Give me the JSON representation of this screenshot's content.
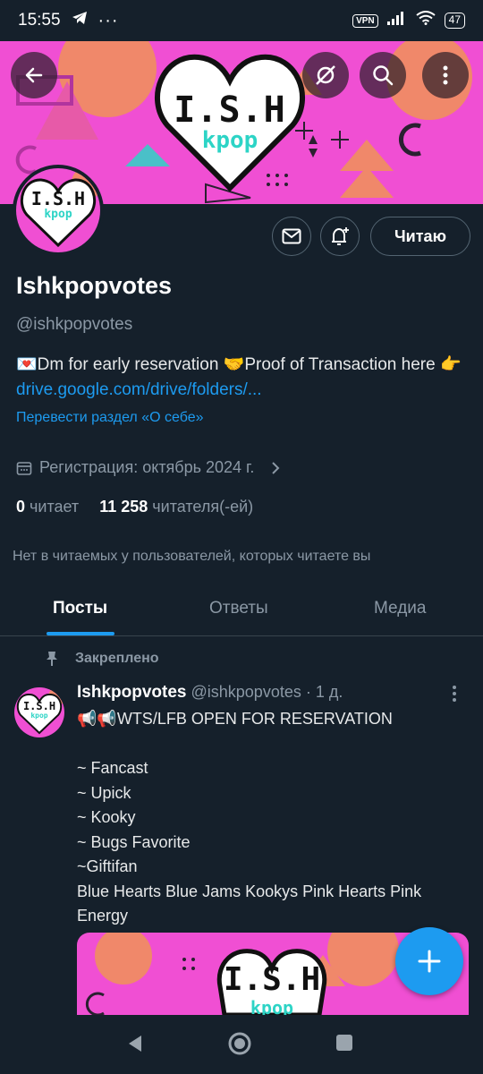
{
  "status_bar": {
    "time": "15:55",
    "vpn": "VPN",
    "battery": "47"
  },
  "banner": {
    "logo_text": "I.S.H",
    "logo_subtext": "kpop"
  },
  "profile": {
    "name": "Ishkpopvotes",
    "handle": "@ishkpopvotes",
    "follow_label": "Читаю",
    "bio_text": "💌Dm for early reservation 🤝Proof of Transaction here 👉 ",
    "bio_link": "drive.google.com/drive/folders/...",
    "translate_label": "Перевести раздел «О себе»",
    "joined": "Регистрация: октябрь 2024 г.",
    "following_count": "0",
    "following_label": "читает",
    "followers_count": "11 258",
    "followers_label": "читателя(-ей)",
    "notice": "Нет в читаемых у пользователей, которых читаете вы"
  },
  "tabs": [
    {
      "label": "Посты",
      "active": true
    },
    {
      "label": "Ответы",
      "active": false
    },
    {
      "label": "Медиа",
      "active": false
    }
  ],
  "post": {
    "pinned_label": "Закреплено",
    "author": "Ishkpopvotes",
    "meta": "@ishkpopvotes · 1 д.",
    "body": "📢📢WTS/LFB OPEN FOR RESERVATION\n\n~ Fancast\n~ Upick\n~ Kooky\n~ Bugs Favorite\n~Giftifan\nBlue Hearts Blue Jams Kookys Pink Hearts Pink Energy"
  },
  "colors": {
    "background": "#15202b",
    "accent": "#1d9bf0",
    "banner_pink": "#f04fd3",
    "logo_teal": "#2dd4c6"
  }
}
